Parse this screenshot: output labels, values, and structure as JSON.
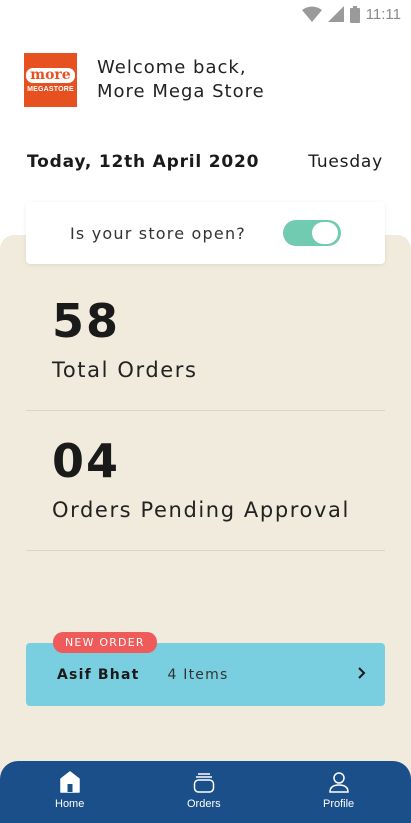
{
  "status": {
    "time": "11:11"
  },
  "brand": {
    "logo_top": "more",
    "logo_bottom": "MEGASTORE"
  },
  "header": {
    "welcome_line1": "Welcome back,",
    "welcome_line2": "More Mega Store"
  },
  "date": {
    "today": "Today, 12th April 2020",
    "weekday": "Tuesday"
  },
  "store_open": {
    "question": "Is your store open?",
    "is_open": true
  },
  "stats": [
    {
      "value": "58",
      "label": "Total Orders"
    },
    {
      "value": "04",
      "label": "Orders Pending Approval"
    }
  ],
  "new_order": {
    "badge": "NEW ORDER",
    "customer": "Asif Bhat",
    "items": "4 Items"
  },
  "nav": {
    "home": "Home",
    "orders": "Orders",
    "profile": "Profile"
  },
  "colors": {
    "brand": "#e6511f",
    "panel": "#f0ebdc",
    "toggle": "#71cbb0",
    "order_card": "#79cfe0",
    "badge": "#ef5b5b",
    "nav": "#1b4f8a"
  }
}
